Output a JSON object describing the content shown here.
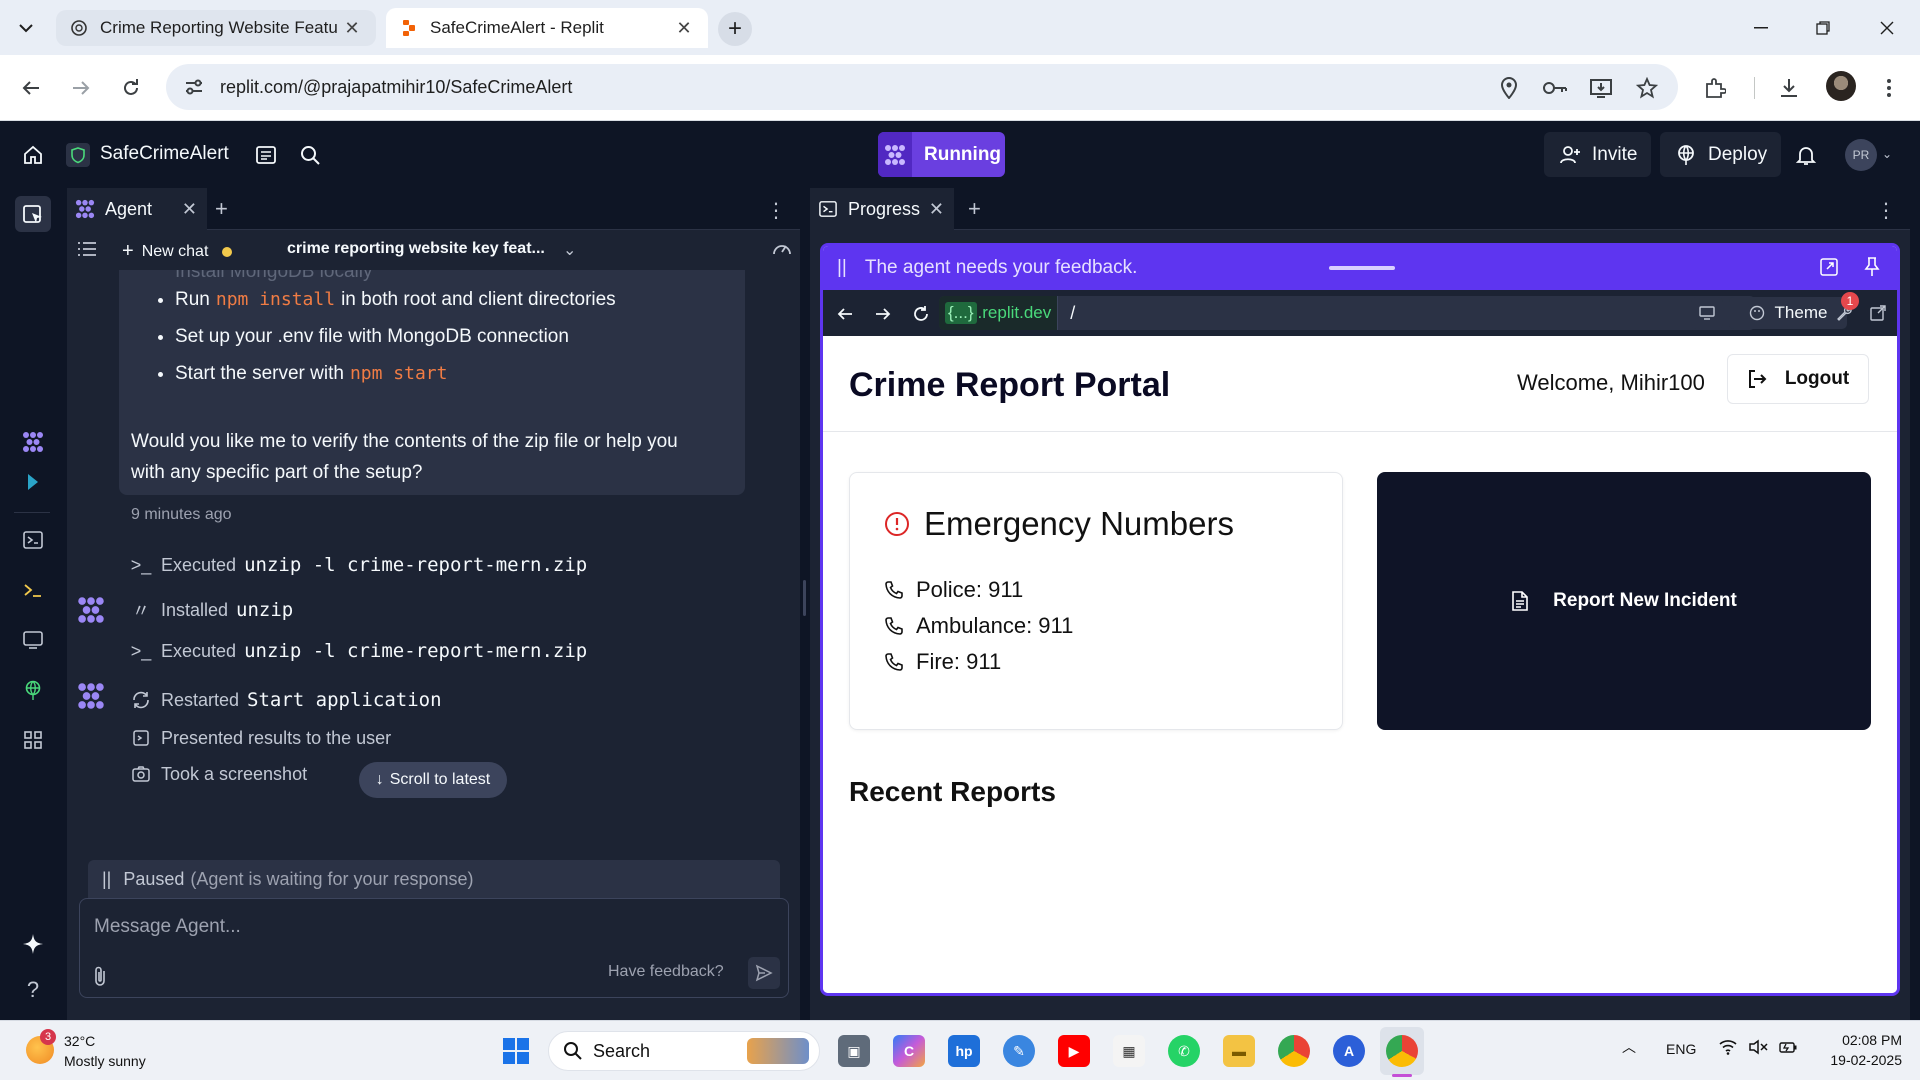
{
  "browser": {
    "tabs": [
      {
        "title": "Crime Reporting Website Featu",
        "active": false
      },
      {
        "title": "SafeCrimeAlert - Replit",
        "active": true
      }
    ],
    "url": "replit.com/@prajapatmihir10/SafeCrimeAlert"
  },
  "replit": {
    "project_name": "SafeCrimeAlert",
    "run_status": "Running",
    "invite_label": "Invite",
    "deploy_label": "Deploy",
    "profile_initials": "PR"
  },
  "agent_panel": {
    "tab_label": "Agent",
    "new_chat_label": "New chat",
    "chat_title": "crime reporting website key feat...",
    "message": {
      "faded_item": "Install MongoDB locally",
      "item1_prefix": "Run",
      "item1_code": "npm install",
      "item1_suffix": "in both root and client directories",
      "item2": "Set up your .env file with MongoDB connection",
      "item3_prefix": "Start the server with",
      "item3_code": "npm start",
      "question": "Would you like me to verify the contents of the zip file or help you with any specific part of the setup?",
      "time": "9 minutes ago"
    },
    "steps": [
      {
        "label": "Executed",
        "code": "unzip -l crime-report-mern.zip"
      },
      {
        "label": "Installed",
        "code": "unzip"
      },
      {
        "label": "Executed",
        "code": "unzip -l crime-report-mern.zip"
      },
      {
        "label": "Restarted",
        "code": "Start application"
      },
      {
        "label": "Presented results to the user",
        "code": ""
      },
      {
        "label": "Took a screenshot",
        "code": ""
      }
    ],
    "scroll_latest": "Scroll to latest",
    "paused_label": "Paused",
    "paused_note": "(Agent is waiting for your response)",
    "input_placeholder": "Message Agent...",
    "feedback_label": "Have feedback?"
  },
  "progress_panel": {
    "tab_label": "Progress",
    "feedback_banner": "The agent needs your feedback.",
    "webview": {
      "domain_braces": "{...}",
      "domain": ".replit.dev",
      "path": "/",
      "theme_label": "Theme",
      "tools_badge": "1"
    },
    "site": {
      "title": "Crime Report Portal",
      "welcome": "Welcome, Mihir100",
      "logout_label": "Logout",
      "emergency_title": "Emergency Numbers",
      "emergency": [
        {
          "label": "Police: 911"
        },
        {
          "label": "Ambulance: 911"
        },
        {
          "label": "Fire: 911"
        }
      ],
      "report_button": "Report New Incident",
      "recent_title": "Recent Reports"
    }
  },
  "taskbar": {
    "weather_temp": "32°C",
    "weather_desc": "Mostly sunny",
    "weather_badge": "3",
    "search_label": "Search",
    "language": "ENG",
    "time": "02:08 PM",
    "date": "19-02-2025"
  },
  "colors": {
    "replit_bg": "#0e1525",
    "panel_bg": "#1c2333",
    "accent_purple": "#5e35f0",
    "code_orange": "#f07c44",
    "report_card": "#0f1427"
  }
}
